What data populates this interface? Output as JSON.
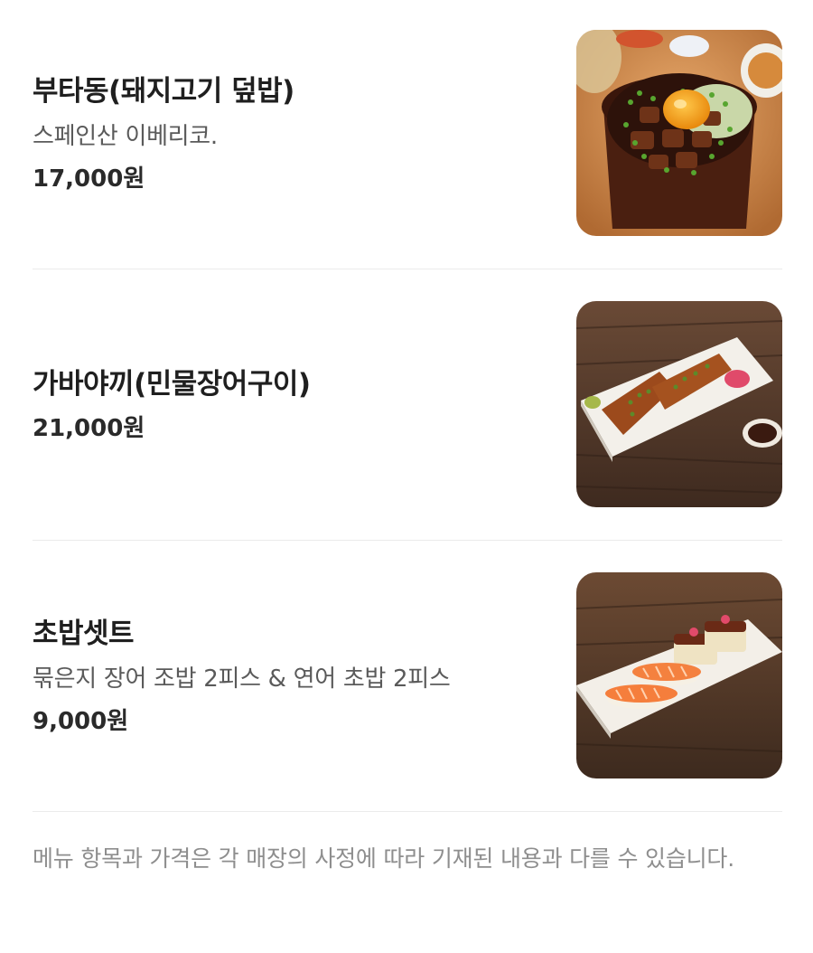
{
  "menu": {
    "items": [
      {
        "name": "부타동(돼지고기 덮밥)",
        "description": "스페인산 이베리코.",
        "price": "17,000원",
        "image_icon": "pork-rice-bowl-image"
      },
      {
        "name": "가바야끼(민물장어구이)",
        "description": "",
        "price": "21,000원",
        "image_icon": "grilled-eel-plate-image"
      },
      {
        "name": "초밥셋트",
        "description": "묶은지 장어 조밥 2피스 & 연어 초밥 2피스",
        "price": "9,000원",
        "image_icon": "sushi-set-plate-image"
      }
    ]
  },
  "notice": {
    "text": "메뉴 항목과 가격은 각 매장의 사정에 따라 기재된 내용과 다를 수 있습니다."
  }
}
